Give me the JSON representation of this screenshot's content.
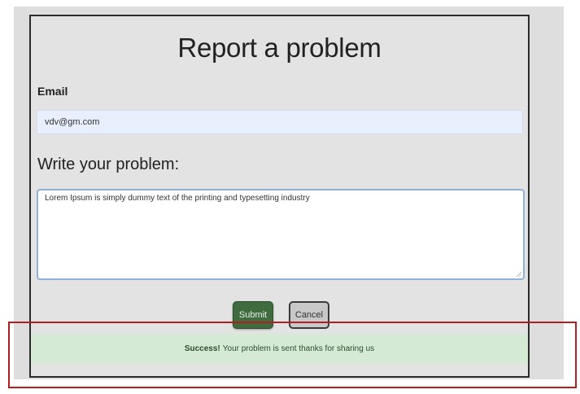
{
  "form": {
    "title": "Report a problem",
    "email_label": "Email",
    "email_value": "vdv@gm.com",
    "problem_label": "Write your problem:",
    "problem_value": "Lorem Ipsum is simply dummy text of the printing and typesetting industry",
    "submit_label": "Submit",
    "cancel_label": "Cancel"
  },
  "alert": {
    "strong": "Success!",
    "message": "Your problem is sent thanks for sharing us"
  },
  "colors": {
    "submit": "#3f6b3f",
    "success_bg": "#d4ead5",
    "highlight": "#b21f1f",
    "input_bg": "#e8f0fe"
  }
}
